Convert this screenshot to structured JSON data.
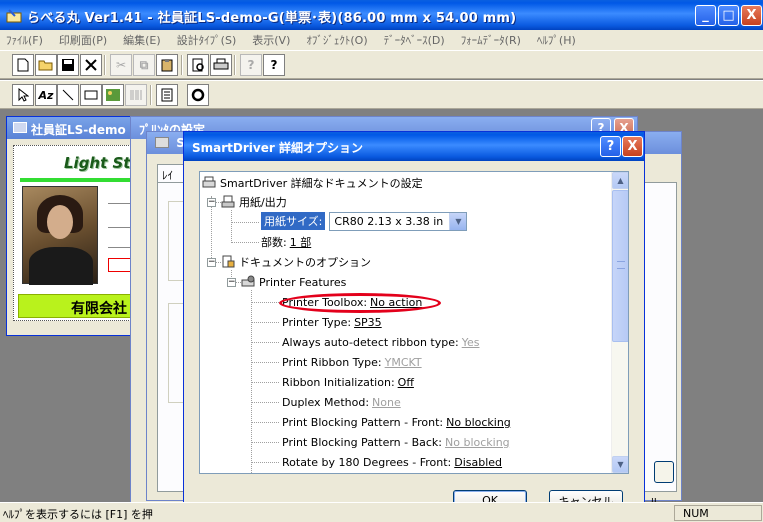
{
  "main_window": {
    "title": "らべる丸 Ver1.41 - 社員証LS-demo-G(単票･表)(86.00 mm x 54.00 mm)",
    "minimize": "_",
    "maximize": "□",
    "close": "X"
  },
  "menubar": [
    "ﾌｧｲﾙ(F)",
    "印刷面(P)",
    "編集(E)",
    "設計ﾀｲﾌﾟ(S)",
    "表示(V)",
    "ｵﾌﾞｼﾞｪｸﾄ(O)",
    "ﾃﾞｰﾀﾍﾞｰｽ(D)",
    "ﾌｫｰﾑﾃﾞｰﾀ(R)",
    "ﾍﾙﾌﾟ(H)"
  ],
  "doc_window": {
    "title": "社員証LS-demo",
    "card_company": "Light Sto",
    "card_bottom": "有限会社"
  },
  "bg_dialogs": {
    "printer_settings_title": "ﾌﾟﾘﾝﾀの設定",
    "second_title": "Sm",
    "tab_label": "ﾚｲ"
  },
  "smartdriver": {
    "title": "SmartDriver 詳細オプション",
    "help_btn": "?",
    "close_btn": "X",
    "tree": {
      "root": "SmartDriver 詳細なドキュメントの設定",
      "paper_group": "用紙/出力",
      "paper_size_label": "用紙サイズ:",
      "paper_size_value": "CR80 2.13 x 3.38 in",
      "copies_label": "部数:",
      "copies_value": "1 部",
      "doc_options": "ドキュメントのオプション",
      "printer_features": "Printer Features",
      "features": [
        {
          "label": "Printer Toolbox:",
          "value": "No action",
          "disabled": false
        },
        {
          "label": "Printer Type:",
          "value": "SP35",
          "disabled": false
        },
        {
          "label": "Always auto-detect ribbon type:",
          "value": "Yes",
          "disabled": true
        },
        {
          "label": "Print Ribbon Type:",
          "value": "YMCKT",
          "disabled": true
        },
        {
          "label": "Ribbon Initialization:",
          "value": "Off",
          "disabled": false
        },
        {
          "label": "Duplex Method:",
          "value": "None",
          "disabled": true
        },
        {
          "label": "Print Blocking Pattern - Front:",
          "value": "No blocking",
          "disabled": false
        },
        {
          "label": "Print Blocking Pattern - Back:",
          "value": "No blocking",
          "disabled": true
        },
        {
          "label": "Rotate by 180 Degrees - Front:",
          "value": "Disabled",
          "disabled": false
        }
      ]
    },
    "ok_label": "OK",
    "cancel_label": "キャンセル"
  },
  "statusbar": {
    "help_text": "ﾍﾙﾌﾟを表示するには [F1] を押",
    "num": "NUM"
  },
  "colors": {
    "xp_title_blue": "#0058e6",
    "highlight_red": "#e3001b",
    "card_green": "#b9f21c"
  }
}
